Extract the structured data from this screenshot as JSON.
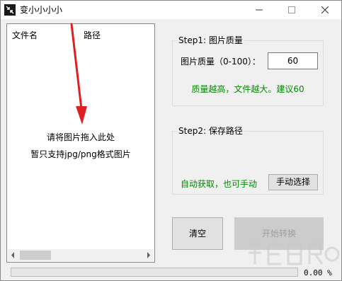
{
  "window": {
    "title": "变小小小小",
    "icon": "compress-arrows-icon",
    "controls": [
      "minimize-icon",
      "maximize-icon",
      "close-icon"
    ]
  },
  "file_list": {
    "columns": [
      "文件名",
      "路径"
    ],
    "hint_line1": "请将图片拖入此处",
    "hint_line2": "暂只支持jpg/png格式图片"
  },
  "step1": {
    "title": "Step1: 图片质量",
    "quality_label": "图片质量（0-100）：",
    "quality_value": "60",
    "tip": "质量越高，文件越大。建议60"
  },
  "step2": {
    "title": "Step2: 保存路径",
    "auto_label": "自动获取，也可手动",
    "manual_button": "手动选择"
  },
  "actions": {
    "clear_button": "清空",
    "convert_button": "开始转换"
  },
  "progress": {
    "value": 0,
    "label": "0.00 %"
  },
  "colors": {
    "accent_green": "#008a00",
    "annotation_arrow": "#e02020"
  }
}
